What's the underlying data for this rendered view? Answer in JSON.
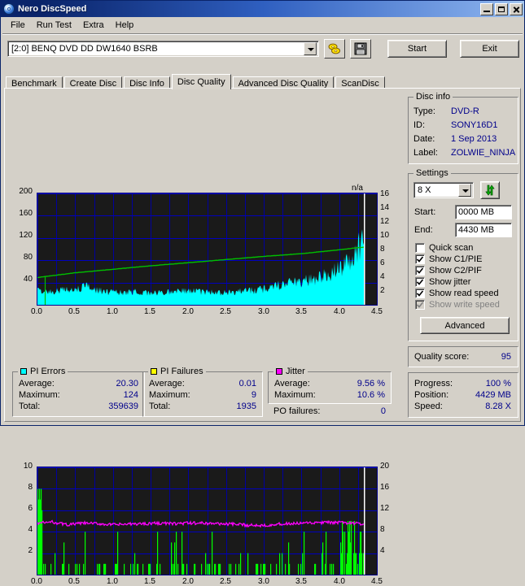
{
  "window": {
    "title": "Nero DiscSpeed",
    "icon": "nero-disc-icon",
    "buttons": {
      "minimize": "_",
      "maximize": "□",
      "close": "✕"
    }
  },
  "menu": {
    "items": [
      "File",
      "Run Test",
      "Extra",
      "Help"
    ]
  },
  "toolbar": {
    "drive": "[2:0]   BENQ DVD DD DW1640 BSRB",
    "eject_icon": "disc-eject-icon",
    "save_icon": "floppy-save-icon",
    "start_label": "Start",
    "exit_label": "Exit"
  },
  "tabs": {
    "items": [
      "Benchmark",
      "Create Disc",
      "Disc Info",
      "Disc Quality",
      "Advanced Disc Quality",
      "ScanDisc"
    ],
    "selected": "Disc Quality"
  },
  "disc_info": {
    "legend": "Disc info",
    "rows": [
      {
        "key": "Type:",
        "value": "DVD-R"
      },
      {
        "key": "ID:",
        "value": "SONY16D1"
      },
      {
        "key": "Date:",
        "value": "1 Sep 2013"
      },
      {
        "key": "Label:",
        "value": "ZOLWIE_NINJA"
      }
    ]
  },
  "settings": {
    "legend": "Settings",
    "speed": "8 X",
    "refresh_icon": "refresh-arrows-icon",
    "start_label": "Start:",
    "start_value": "0000 MB",
    "end_label": "End:",
    "end_value": "4430 MB",
    "checkboxes": [
      {
        "label": "Quick scan",
        "checked": false,
        "disabled": false
      },
      {
        "label": "Show C1/PIE",
        "checked": true,
        "disabled": false
      },
      {
        "label": "Show C2/PIF",
        "checked": true,
        "disabled": false
      },
      {
        "label": "Show jitter",
        "checked": true,
        "disabled": false
      },
      {
        "label": "Show read speed",
        "checked": true,
        "disabled": false
      },
      {
        "label": "Show write speed",
        "checked": true,
        "disabled": true
      }
    ],
    "advanced_label": "Advanced"
  },
  "quality": {
    "label": "Quality score:",
    "value": "95"
  },
  "status": {
    "rows": [
      {
        "key": "Progress:",
        "value": "100 %"
      },
      {
        "key": "Position:",
        "value": "4429 MB"
      },
      {
        "key": "Speed:",
        "value": "8.28 X"
      }
    ]
  },
  "stats": {
    "pi_errors": {
      "legend": "PI Errors",
      "color": "#00ffff",
      "rows": [
        {
          "key": "Average:",
          "value": "20.30"
        },
        {
          "key": "Maximum:",
          "value": "124"
        },
        {
          "key": "Total:",
          "value": "359639"
        }
      ]
    },
    "pi_failures": {
      "legend": "PI Failures",
      "color": "#ffff00",
      "rows": [
        {
          "key": "Average:",
          "value": "0.01"
        },
        {
          "key": "Maximum:",
          "value": "9"
        },
        {
          "key": "Total:",
          "value": "1935"
        }
      ]
    },
    "jitter": {
      "legend": "Jitter",
      "color": "#ff00ff",
      "rows": [
        {
          "key": "Average:",
          "value": "9.56 %"
        },
        {
          "key": "Maximum:",
          "value": "10.6 %"
        }
      ],
      "po_label": "PO failures:",
      "po_value": "0"
    }
  },
  "chart_data": [
    {
      "type": "area",
      "name": "pie-chart",
      "title": "",
      "annotation": "n/a",
      "xlabel": "",
      "ylabel": "",
      "x": [
        0.0,
        0.5,
        1.0,
        1.5,
        2.0,
        2.5,
        3.0,
        3.5,
        4.0,
        4.5
      ],
      "xticklabels": [
        "0.0",
        "0.5",
        "1.0",
        "1.5",
        "2.0",
        "2.5",
        "3.0",
        "3.5",
        "4.0",
        "4.5"
      ],
      "xlim": [
        0.0,
        4.5
      ],
      "left_axis": {
        "lim": [
          0,
          200
        ],
        "ticks": [
          40,
          80,
          120,
          160,
          200
        ],
        "ticklabels": [
          "40",
          "80",
          "120",
          "160",
          "200"
        ]
      },
      "right_axis": {
        "lim": [
          0,
          16
        ],
        "ticks": [
          2,
          4,
          6,
          8,
          10,
          12,
          14,
          16
        ],
        "ticklabels": [
          "2",
          "4",
          "6",
          "8",
          "10",
          "12",
          "14",
          "16"
        ]
      },
      "grid": true,
      "data_end_x": 4.33,
      "series": [
        {
          "name": "PI Errors",
          "color": "#00ffff",
          "axis": "left",
          "render": "filled-noise",
          "x": [
            0.0,
            0.1,
            0.2,
            0.3,
            0.4,
            0.5,
            0.6,
            0.65,
            0.7,
            0.8,
            0.9,
            1.0,
            1.1,
            1.2,
            1.3,
            1.4,
            1.5,
            1.6,
            1.7,
            1.8,
            1.9,
            2.0,
            2.1,
            2.2,
            2.3,
            2.4,
            2.5,
            2.6,
            2.7,
            2.8,
            2.9,
            3.0,
            3.1,
            3.2,
            3.3,
            3.4,
            3.5,
            3.6,
            3.7,
            3.8,
            3.9,
            4.0,
            4.05,
            4.1,
            4.15,
            4.2,
            4.25,
            4.3,
            4.33
          ],
          "values": [
            28,
            22,
            21,
            25,
            27,
            24,
            29,
            32,
            28,
            25,
            22,
            21,
            21,
            22,
            22,
            21,
            20,
            20,
            21,
            22,
            23,
            24,
            23,
            22,
            21,
            21,
            21,
            22,
            23,
            24,
            25,
            27,
            30,
            33,
            36,
            38,
            40,
            43,
            46,
            50,
            55,
            60,
            66,
            72,
            78,
            86,
            95,
            112,
            118
          ]
        },
        {
          "name": "Read speed",
          "color": "#00c000",
          "axis": "right",
          "render": "line",
          "x": [
            0.0,
            0.05,
            0.1,
            0.5,
            1.0,
            1.5,
            2.0,
            2.5,
            3.0,
            3.5,
            4.0,
            4.2,
            4.33
          ],
          "values": [
            3.9,
            4.0,
            4.05,
            4.6,
            5.1,
            5.6,
            6.05,
            6.5,
            6.95,
            7.35,
            7.9,
            8.15,
            8.28
          ]
        }
      ]
    },
    {
      "type": "bar",
      "name": "pif-jitter-chart",
      "title": "",
      "xlabel": "",
      "ylabel": "",
      "xticklabels": [
        "0.0",
        "0.5",
        "1.0",
        "1.5",
        "2.0",
        "2.5",
        "3.0",
        "3.5",
        "4.0",
        "4.5"
      ],
      "xlim": [
        0.0,
        4.5
      ],
      "left_axis": {
        "lim": [
          0,
          10
        ],
        "ticks": [
          2,
          4,
          6,
          8,
          10
        ],
        "ticklabels": [
          "2",
          "4",
          "6",
          "8",
          "10"
        ]
      },
      "right_axis": {
        "lim": [
          0,
          20
        ],
        "ticks": [
          4,
          8,
          12,
          16,
          20
        ],
        "ticklabels": [
          "4",
          "8",
          "12",
          "16",
          "20"
        ]
      },
      "grid": true,
      "data_end_x": 4.33,
      "series": [
        {
          "name": "PI Failures",
          "color": "#00ff00",
          "axis": "left",
          "render": "spikes",
          "max_value": 9
        },
        {
          "name": "Jitter",
          "color": "#ff00ff",
          "axis": "right",
          "render": "line",
          "x": [
            0.0,
            0.2,
            0.4,
            0.6,
            0.8,
            1.0,
            1.2,
            1.4,
            1.6,
            1.8,
            2.0,
            2.2,
            2.4,
            2.6,
            2.8,
            3.0,
            3.2,
            3.4,
            3.6,
            3.8,
            4.0,
            4.2,
            4.3
          ],
          "values": [
            9.6,
            9.8,
            9.3,
            9.6,
            9.5,
            9.3,
            9.4,
            9.5,
            9.6,
            9.5,
            9.6,
            9.6,
            9.5,
            9.4,
            9.2,
            9.2,
            9.4,
            9.5,
            9.6,
            9.7,
            9.7,
            9.6,
            9.4
          ]
        }
      ]
    }
  ]
}
